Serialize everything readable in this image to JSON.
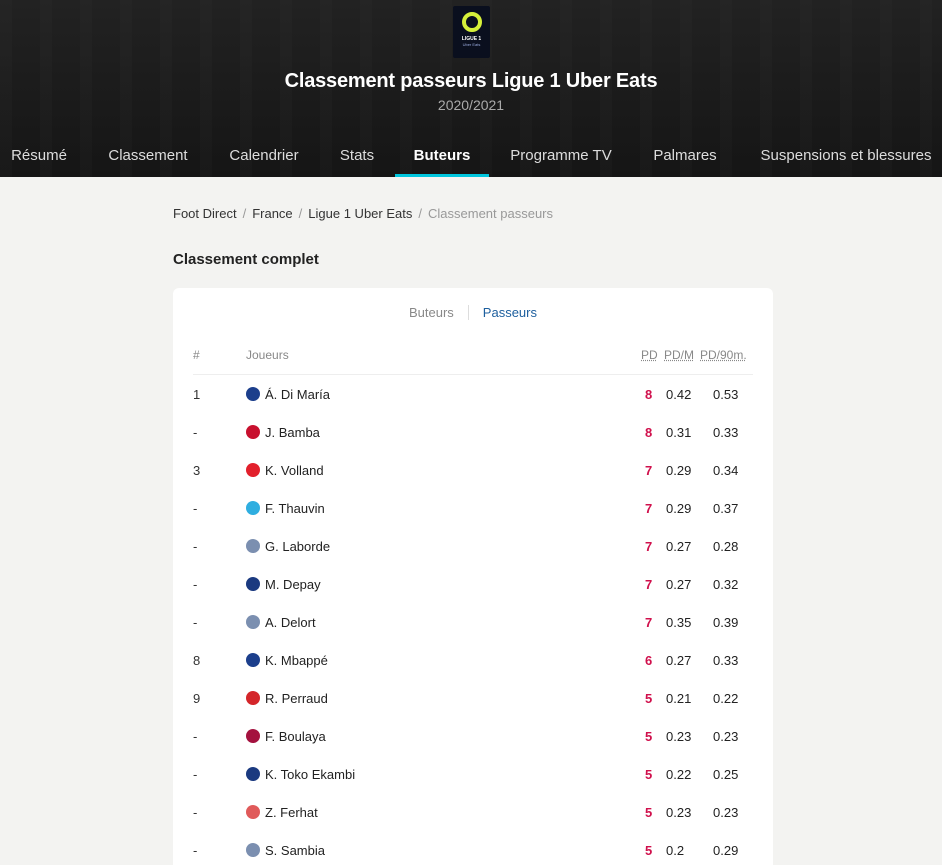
{
  "header": {
    "logo_text": "LIGUE 1",
    "logo_sub": "Uber Eats",
    "title": "Classement passeurs Ligue 1 Uber Eats",
    "season": "2020/2021"
  },
  "nav": [
    {
      "label": "Résumé"
    },
    {
      "label": "Classement"
    },
    {
      "label": "Calendrier"
    },
    {
      "label": "Stats"
    },
    {
      "label": "Buteurs"
    },
    {
      "label": "Programme TV"
    },
    {
      "label": "Palmares"
    },
    {
      "label": "Suspensions et blessures"
    }
  ],
  "breadcrumb": [
    "Foot Direct",
    "France",
    "Ligue 1 Uber Eats",
    "Classement passeurs"
  ],
  "section_title": "Classement complet",
  "toggle": {
    "off": "Buteurs",
    "on": "Passeurs"
  },
  "table": {
    "headers": {
      "rank": "#",
      "player": "Joueurs",
      "pd": "PD",
      "pdm": "PD/M",
      "pd90": "PD/90m."
    },
    "rows": [
      {
        "rank": "1",
        "name": "Á. Di María",
        "pd": "8",
        "pdm": "0.42",
        "pd90": "0.53",
        "crest": "#1c3f8c"
      },
      {
        "rank": "-",
        "name": "J. Bamba",
        "pd": "8",
        "pdm": "0.31",
        "pd90": "0.33",
        "crest": "#c8102e"
      },
      {
        "rank": "3",
        "name": "K. Volland",
        "pd": "7",
        "pdm": "0.29",
        "pd90": "0.34",
        "crest": "#e2202c"
      },
      {
        "rank": "-",
        "name": "F. Thauvin",
        "pd": "7",
        "pdm": "0.29",
        "pd90": "0.37",
        "crest": "#2faee0"
      },
      {
        "rank": "-",
        "name": "G. Laborde",
        "pd": "7",
        "pdm": "0.27",
        "pd90": "0.28",
        "crest": "#7b8fb0"
      },
      {
        "rank": "-",
        "name": "M. Depay",
        "pd": "7",
        "pdm": "0.27",
        "pd90": "0.32",
        "crest": "#1b3a80"
      },
      {
        "rank": "-",
        "name": "A. Delort",
        "pd": "7",
        "pdm": "0.35",
        "pd90": "0.39",
        "crest": "#7b8fb0"
      },
      {
        "rank": "8",
        "name": "K. Mbappé",
        "pd": "6",
        "pdm": "0.27",
        "pd90": "0.33",
        "crest": "#1c3f8c"
      },
      {
        "rank": "9",
        "name": "R. Perraud",
        "pd": "5",
        "pdm": "0.21",
        "pd90": "0.22",
        "crest": "#d4262a"
      },
      {
        "rank": "-",
        "name": "F. Boulaya",
        "pd": "5",
        "pdm": "0.23",
        "pd90": "0.23",
        "crest": "#a4123f"
      },
      {
        "rank": "-",
        "name": "K. Toko Ekambi",
        "pd": "5",
        "pdm": "0.22",
        "pd90": "0.25",
        "crest": "#1b3a80"
      },
      {
        "rank": "-",
        "name": "Z. Ferhat",
        "pd": "5",
        "pdm": "0.23",
        "pd90": "0.23",
        "crest": "#e05a5a"
      },
      {
        "rank": "-",
        "name": "S. Sambia",
        "pd": "5",
        "pdm": "0.2",
        "pd90": "0.29",
        "crest": "#7b8fb0"
      }
    ]
  },
  "colors": {
    "accent": "#00c6dd",
    "pd": "#d0104c",
    "link": "#1d5f9e"
  }
}
